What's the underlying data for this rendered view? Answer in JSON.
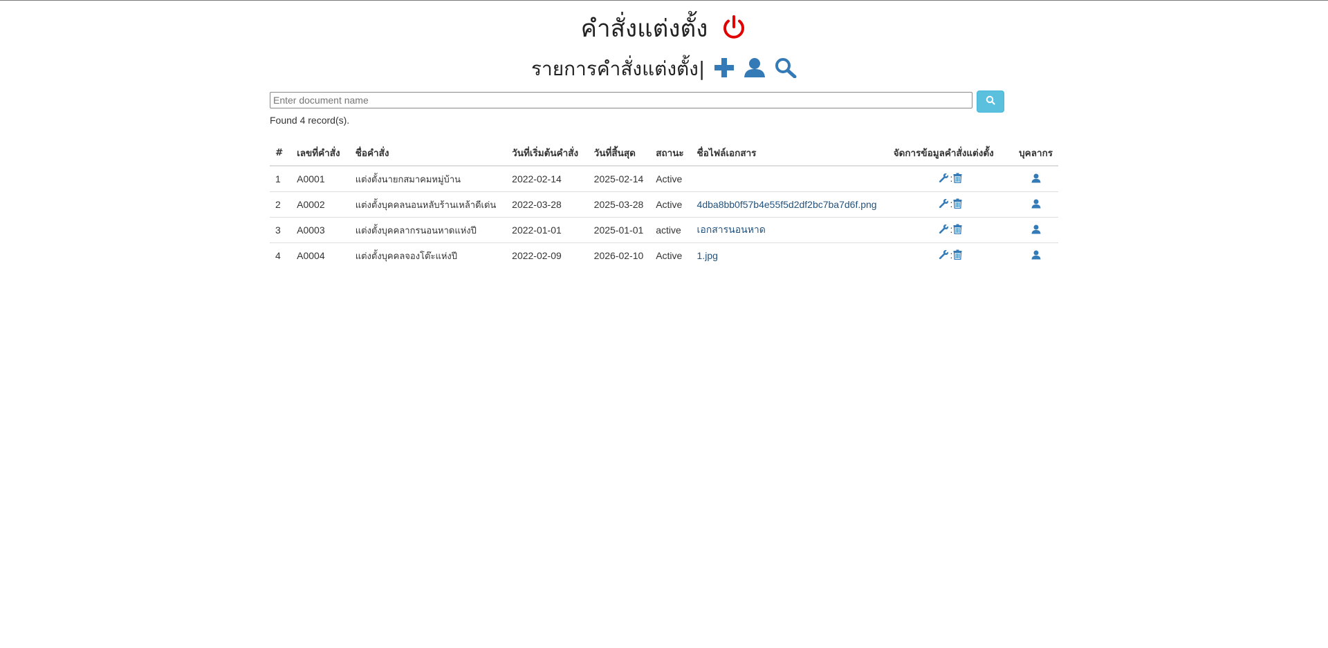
{
  "page": {
    "title": "คำสั่งแต่งตั้ง",
    "subtitle": "รายการคำสั่งแต่งตั้ง|"
  },
  "toolbar": {
    "icons": [
      "power-icon",
      "plus-icon",
      "user-icon",
      "search-icon"
    ],
    "colors": {
      "power": "#e00000",
      "toolbar": "#337ab7"
    }
  },
  "search": {
    "placeholder": "Enter document name",
    "value": "",
    "button_icon": "search-icon",
    "button_color": "#5bc0de"
  },
  "result": {
    "found_text": "Found 4 record(s)."
  },
  "table": {
    "headers": {
      "index": "#",
      "number": "เลขที่คำสั่ง",
      "name": "ชื่อคำสั่ง",
      "start": "วันที่เริ่มต้นคำสั่ง",
      "end": "วันที่สิ้นสุด",
      "status": "สถานะ",
      "file": "ชื่อไฟล์เอกสาร",
      "manage": "จัดการข้อมูลคำสั่งแต่งตั้ง",
      "personnel": "บุคลากร"
    },
    "rows": [
      {
        "index": "1",
        "number": "A0001",
        "name": "แต่งตั้งนายกสมาคมหมู่บ้าน",
        "start": "2022-02-14",
        "end": "2025-02-14",
        "status": "Active",
        "file": ""
      },
      {
        "index": "2",
        "number": "A0002",
        "name": "แต่งตั้งบุคคลนอนหลับร้านเหล้าดีเด่น",
        "start": "2022-03-28",
        "end": "2025-03-28",
        "status": "Active",
        "file": "4dba8bb0f57b4e55f5d2df2bc7ba7d6f.png"
      },
      {
        "index": "3",
        "number": "A0003",
        "name": "แต่งตั้งบุคคลากรนอนหาดแห่งปี",
        "start": "2022-01-01",
        "end": "2025-01-01",
        "status": "active",
        "file": "เอกสารนอนหาด"
      },
      {
        "index": "4",
        "number": "A0004",
        "name": "แต่งตั้งบุคคลจองโต๊ะแห่งปี",
        "start": "2022-02-09",
        "end": "2026-02-10",
        "status": "Active",
        "file": "1.jpg"
      }
    ],
    "row_action_icons": [
      "wrench-icon",
      "trash-icon",
      "user-icon"
    ],
    "action_separator": ":"
  }
}
